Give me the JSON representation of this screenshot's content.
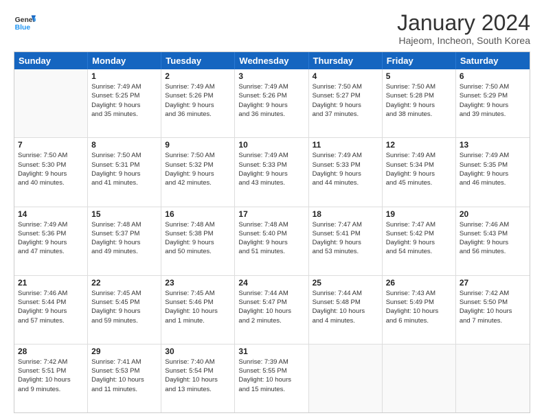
{
  "header": {
    "logo": {
      "line1": "General",
      "line2": "Blue"
    },
    "title": "January 2024",
    "location": "Hajeom, Incheon, South Korea"
  },
  "days_of_week": [
    "Sunday",
    "Monday",
    "Tuesday",
    "Wednesday",
    "Thursday",
    "Friday",
    "Saturday"
  ],
  "weeks": [
    [
      {
        "day": "",
        "lines": []
      },
      {
        "day": "1",
        "lines": [
          "Sunrise: 7:49 AM",
          "Sunset: 5:25 PM",
          "Daylight: 9 hours",
          "and 35 minutes."
        ]
      },
      {
        "day": "2",
        "lines": [
          "Sunrise: 7:49 AM",
          "Sunset: 5:26 PM",
          "Daylight: 9 hours",
          "and 36 minutes."
        ]
      },
      {
        "day": "3",
        "lines": [
          "Sunrise: 7:49 AM",
          "Sunset: 5:26 PM",
          "Daylight: 9 hours",
          "and 36 minutes."
        ]
      },
      {
        "day": "4",
        "lines": [
          "Sunrise: 7:50 AM",
          "Sunset: 5:27 PM",
          "Daylight: 9 hours",
          "and 37 minutes."
        ]
      },
      {
        "day": "5",
        "lines": [
          "Sunrise: 7:50 AM",
          "Sunset: 5:28 PM",
          "Daylight: 9 hours",
          "and 38 minutes."
        ]
      },
      {
        "day": "6",
        "lines": [
          "Sunrise: 7:50 AM",
          "Sunset: 5:29 PM",
          "Daylight: 9 hours",
          "and 39 minutes."
        ]
      }
    ],
    [
      {
        "day": "7",
        "lines": [
          "Sunrise: 7:50 AM",
          "Sunset: 5:30 PM",
          "Daylight: 9 hours",
          "and 40 minutes."
        ]
      },
      {
        "day": "8",
        "lines": [
          "Sunrise: 7:50 AM",
          "Sunset: 5:31 PM",
          "Daylight: 9 hours",
          "and 41 minutes."
        ]
      },
      {
        "day": "9",
        "lines": [
          "Sunrise: 7:50 AM",
          "Sunset: 5:32 PM",
          "Daylight: 9 hours",
          "and 42 minutes."
        ]
      },
      {
        "day": "10",
        "lines": [
          "Sunrise: 7:49 AM",
          "Sunset: 5:33 PM",
          "Daylight: 9 hours",
          "and 43 minutes."
        ]
      },
      {
        "day": "11",
        "lines": [
          "Sunrise: 7:49 AM",
          "Sunset: 5:33 PM",
          "Daylight: 9 hours",
          "and 44 minutes."
        ]
      },
      {
        "day": "12",
        "lines": [
          "Sunrise: 7:49 AM",
          "Sunset: 5:34 PM",
          "Daylight: 9 hours",
          "and 45 minutes."
        ]
      },
      {
        "day": "13",
        "lines": [
          "Sunrise: 7:49 AM",
          "Sunset: 5:35 PM",
          "Daylight: 9 hours",
          "and 46 minutes."
        ]
      }
    ],
    [
      {
        "day": "14",
        "lines": [
          "Sunrise: 7:49 AM",
          "Sunset: 5:36 PM",
          "Daylight: 9 hours",
          "and 47 minutes."
        ]
      },
      {
        "day": "15",
        "lines": [
          "Sunrise: 7:48 AM",
          "Sunset: 5:37 PM",
          "Daylight: 9 hours",
          "and 49 minutes."
        ]
      },
      {
        "day": "16",
        "lines": [
          "Sunrise: 7:48 AM",
          "Sunset: 5:38 PM",
          "Daylight: 9 hours",
          "and 50 minutes."
        ]
      },
      {
        "day": "17",
        "lines": [
          "Sunrise: 7:48 AM",
          "Sunset: 5:40 PM",
          "Daylight: 9 hours",
          "and 51 minutes."
        ]
      },
      {
        "day": "18",
        "lines": [
          "Sunrise: 7:47 AM",
          "Sunset: 5:41 PM",
          "Daylight: 9 hours",
          "and 53 minutes."
        ]
      },
      {
        "day": "19",
        "lines": [
          "Sunrise: 7:47 AM",
          "Sunset: 5:42 PM",
          "Daylight: 9 hours",
          "and 54 minutes."
        ]
      },
      {
        "day": "20",
        "lines": [
          "Sunrise: 7:46 AM",
          "Sunset: 5:43 PM",
          "Daylight: 9 hours",
          "and 56 minutes."
        ]
      }
    ],
    [
      {
        "day": "21",
        "lines": [
          "Sunrise: 7:46 AM",
          "Sunset: 5:44 PM",
          "Daylight: 9 hours",
          "and 57 minutes."
        ]
      },
      {
        "day": "22",
        "lines": [
          "Sunrise: 7:45 AM",
          "Sunset: 5:45 PM",
          "Daylight: 9 hours",
          "and 59 minutes."
        ]
      },
      {
        "day": "23",
        "lines": [
          "Sunrise: 7:45 AM",
          "Sunset: 5:46 PM",
          "Daylight: 10 hours",
          "and 1 minute."
        ]
      },
      {
        "day": "24",
        "lines": [
          "Sunrise: 7:44 AM",
          "Sunset: 5:47 PM",
          "Daylight: 10 hours",
          "and 2 minutes."
        ]
      },
      {
        "day": "25",
        "lines": [
          "Sunrise: 7:44 AM",
          "Sunset: 5:48 PM",
          "Daylight: 10 hours",
          "and 4 minutes."
        ]
      },
      {
        "day": "26",
        "lines": [
          "Sunrise: 7:43 AM",
          "Sunset: 5:49 PM",
          "Daylight: 10 hours",
          "and 6 minutes."
        ]
      },
      {
        "day": "27",
        "lines": [
          "Sunrise: 7:42 AM",
          "Sunset: 5:50 PM",
          "Daylight: 10 hours",
          "and 7 minutes."
        ]
      }
    ],
    [
      {
        "day": "28",
        "lines": [
          "Sunrise: 7:42 AM",
          "Sunset: 5:51 PM",
          "Daylight: 10 hours",
          "and 9 minutes."
        ]
      },
      {
        "day": "29",
        "lines": [
          "Sunrise: 7:41 AM",
          "Sunset: 5:53 PM",
          "Daylight: 10 hours",
          "and 11 minutes."
        ]
      },
      {
        "day": "30",
        "lines": [
          "Sunrise: 7:40 AM",
          "Sunset: 5:54 PM",
          "Daylight: 10 hours",
          "and 13 minutes."
        ]
      },
      {
        "day": "31",
        "lines": [
          "Sunrise: 7:39 AM",
          "Sunset: 5:55 PM",
          "Daylight: 10 hours",
          "and 15 minutes."
        ]
      },
      {
        "day": "",
        "lines": []
      },
      {
        "day": "",
        "lines": []
      },
      {
        "day": "",
        "lines": []
      }
    ]
  ]
}
